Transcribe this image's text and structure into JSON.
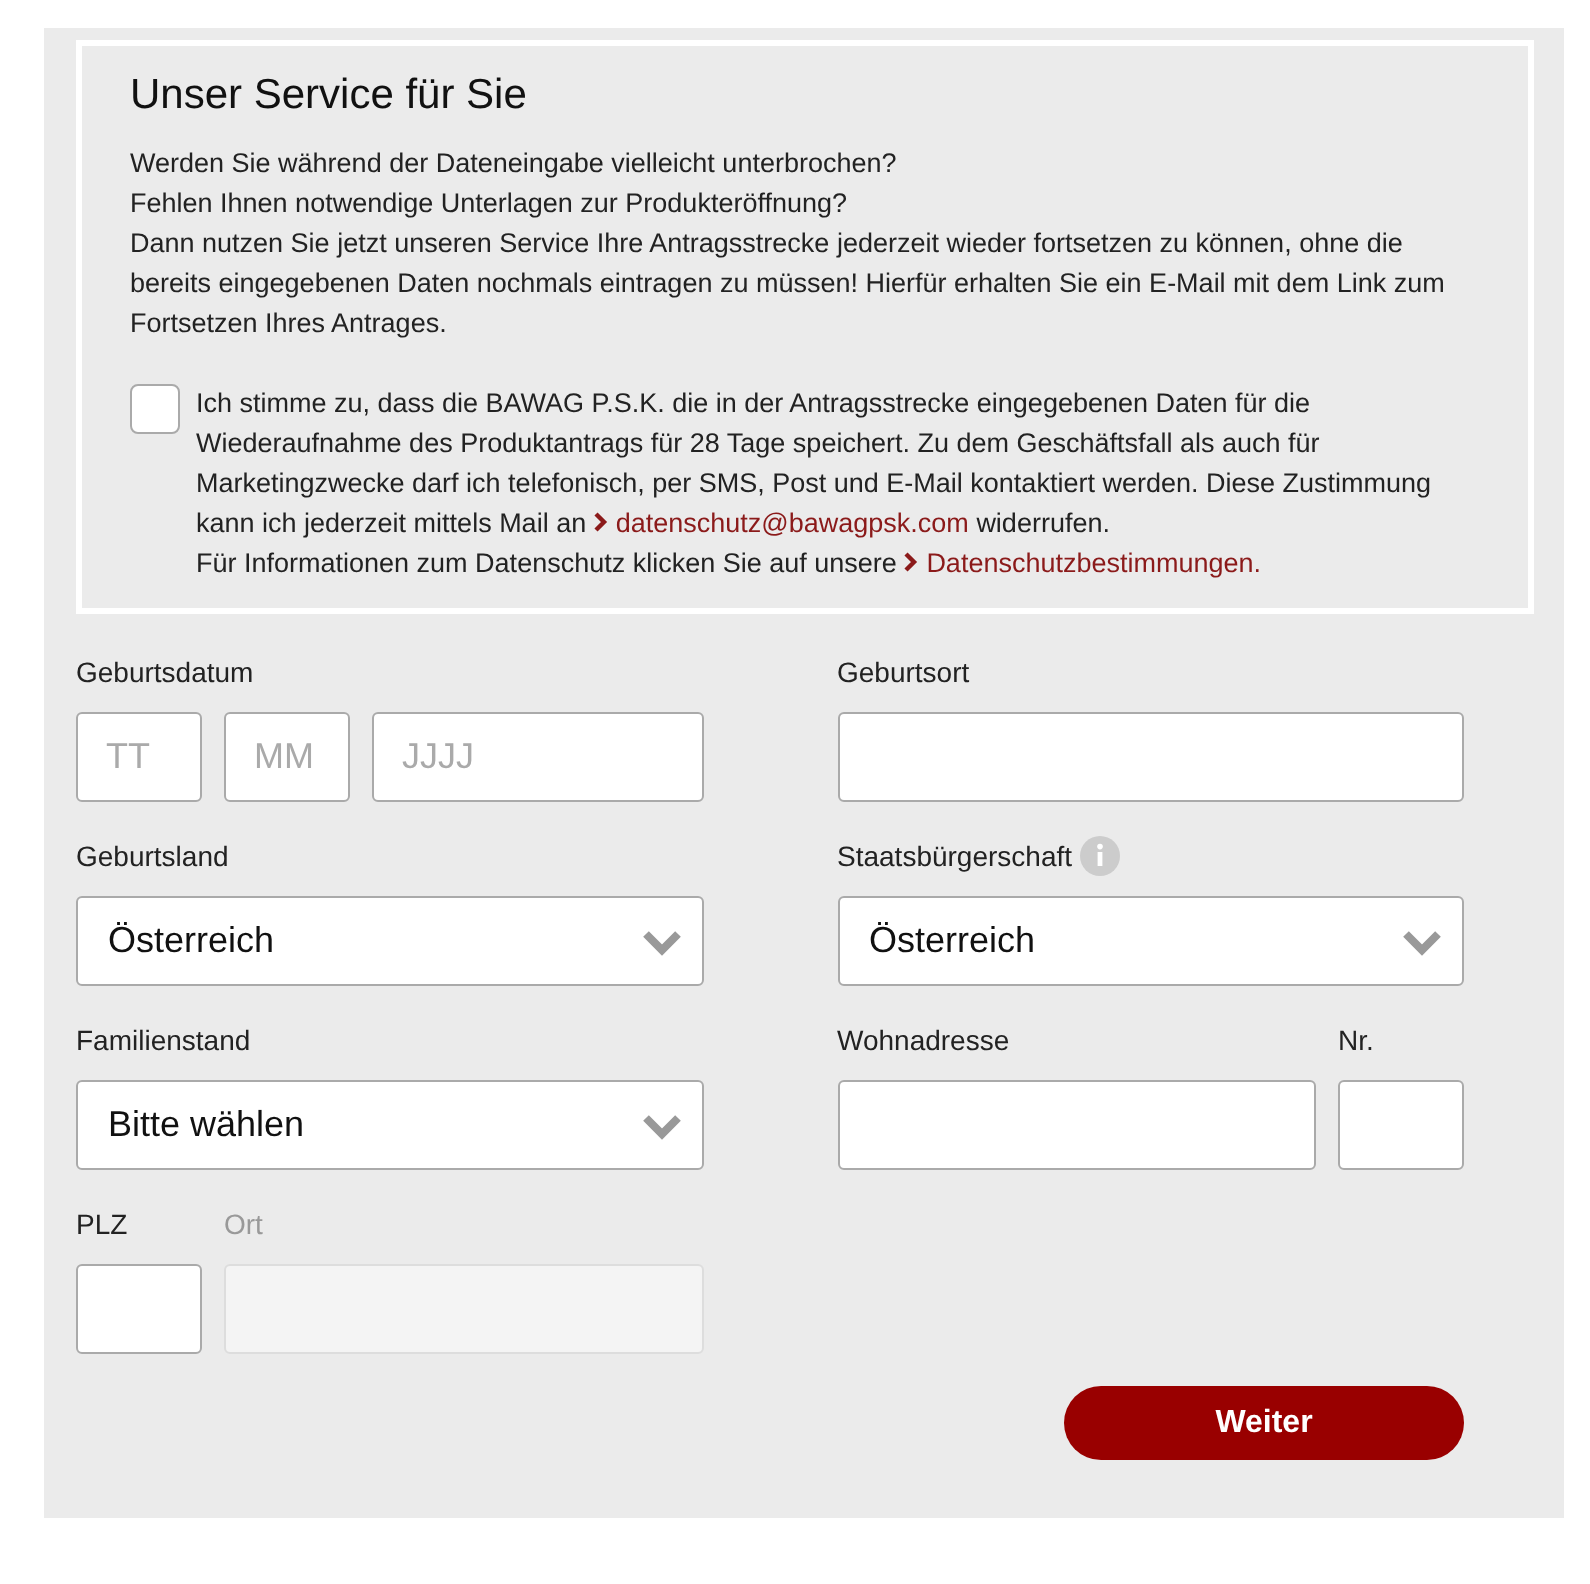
{
  "service": {
    "title": "Unser Service für Sie",
    "paragraphs": [
      "Werden Sie während der Dateneingabe vielleicht unterbrochen?",
      "Fehlen Ihnen notwendige Unterlagen zur Produkteröffnung?",
      "Dann nutzen Sie jetzt unseren Service Ihre Antragsstrecke jederzeit wieder fortsetzen zu können, ohne die bereits eingegebenen Daten nochmals eintragen zu müssen! Hierfür erhalten Sie ein E-Mail mit dem Link zum Fortsetzen Ihres Antrages."
    ],
    "consent": {
      "checked": false,
      "text": "Ich stimme zu, dass die BAWAG P.S.K. die in der Antragsstrecke eingegebenen Daten für die Wiederaufnahme des Produktantrags für 28 Tage speichert. Zu dem Geschäftsfall als auch für Marketingzwecke darf ich telefonisch, per SMS, Post und E-Mail kontaktiert werden. Diese Zustimmung kann ich jederzeit mittels Mail an",
      "email_link": "datenschutz@bawagpsk.com",
      "text_after": "widerrufen.",
      "info_text": "Für Informationen zum Datenschutz klicken Sie auf unsere",
      "policy_link": "Datenschutzbestimmungen."
    }
  },
  "form": {
    "rows": [
      {
        "left": [
          {
            "kind": "date",
            "label": "Geburtsdatum",
            "disabled": false,
            "info": false,
            "placeholders": [
              "TT",
              "MM",
              "JJJJ"
            ]
          }
        ],
        "right": [
          {
            "kind": "text",
            "label": "Geburtsort",
            "disabled": false,
            "info": false
          }
        ]
      },
      {
        "left": [
          {
            "kind": "select",
            "label": "Geburtsland",
            "disabled": false,
            "info": false,
            "value": "Österreich"
          }
        ],
        "right": [
          {
            "kind": "select",
            "label": "Staatsbürgerschaft",
            "disabled": false,
            "info": true,
            "value": "Österreich"
          }
        ]
      },
      {
        "left": [
          {
            "kind": "select",
            "label": "Familienstand",
            "disabled": false,
            "info": false,
            "value": "Bitte wählen"
          }
        ],
        "right": [
          {
            "kind": "text",
            "label": "Wohnadresse",
            "disabled": false,
            "info": false
          },
          {
            "kind": "short",
            "label": "Nr.",
            "disabled": false,
            "info": false
          }
        ]
      },
      {
        "left": [
          {
            "kind": "short",
            "label": "PLZ",
            "disabled": false,
            "info": false
          },
          {
            "kind": "text",
            "label": "Ort",
            "disabled": true,
            "info": false
          }
        ]
      }
    ]
  },
  "submit": {
    "label": "Weiter"
  }
}
